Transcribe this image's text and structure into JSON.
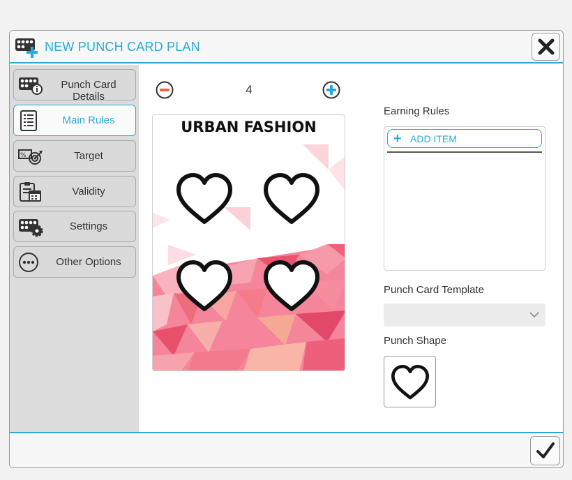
{
  "dialog": {
    "title": "NEW PUNCH CARD PLAN",
    "title_icon": "punch-card-add-icon",
    "close_icon": "close-icon",
    "confirm_icon": "checkmark-icon",
    "accent_color": "#2aa8dc"
  },
  "sidebar": {
    "items": [
      {
        "label": "Punch Card Details",
        "icon": "punch-card-info-icon",
        "active": false
      },
      {
        "label": "Main Rules",
        "icon": "list-icon",
        "active": true
      },
      {
        "label": "Target",
        "icon": "target-icon",
        "active": false
      },
      {
        "label": "Validity",
        "icon": "calendar-icon",
        "active": false
      },
      {
        "label": "Settings",
        "icon": "punch-card-settings-icon",
        "active": false
      },
      {
        "label": "Other Options",
        "icon": "more-options-icon",
        "active": false
      }
    ]
  },
  "main": {
    "stepper": {
      "value": "4",
      "minus_icon": "minus-circle-icon",
      "plus_icon": "plus-circle-icon"
    },
    "card": {
      "title": "URBAN FASHION",
      "punch_icon": "heart-icon",
      "punch_count": 4
    },
    "earning_rules": {
      "label": "Earning Rules",
      "add_item_label": "ADD ITEM",
      "add_icon": "plus-icon"
    },
    "punch_card_template": {
      "label": "Punch Card Template",
      "value": "",
      "chevron_icon": "chevron-down-icon"
    },
    "punch_shape": {
      "label": "Punch Shape",
      "icon": "heart-icon"
    }
  }
}
